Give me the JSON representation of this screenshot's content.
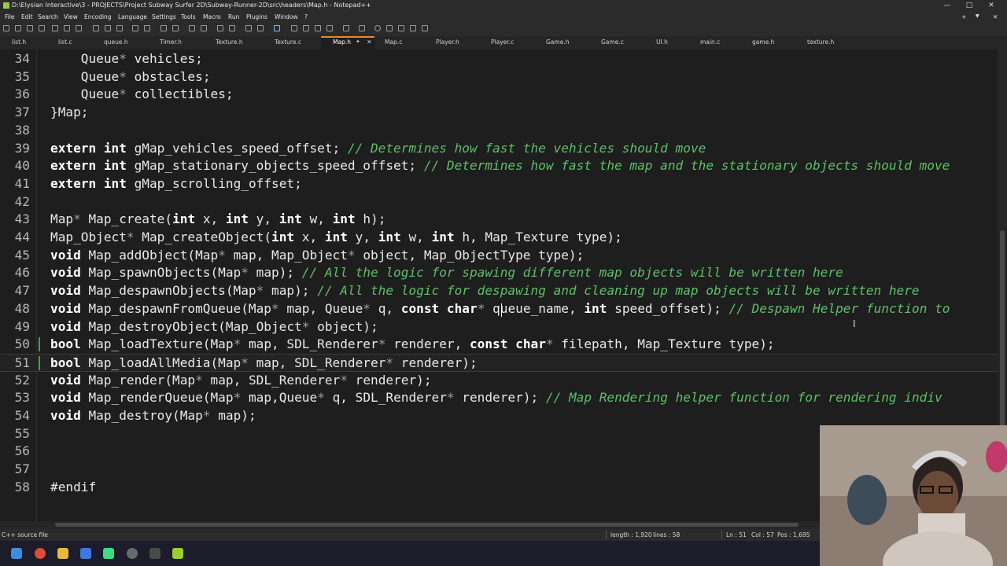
{
  "window": {
    "title": "D:\\Elysian Interactive\\3 - PROJECTS\\Project Subway Surfer 2D\\Subway-Runner-2D\\src\\headers\\Map.h - Notepad++",
    "minimize": "—",
    "maximize": "□",
    "close": "✕"
  },
  "menu": [
    "File",
    "Edit",
    "Search",
    "View",
    "Encoding",
    "Language",
    "Settings",
    "Tools",
    "Macro",
    "Run",
    "Plugins",
    "Window",
    "?"
  ],
  "menu_right": {
    "add": "+",
    "dropdown": "▼",
    "close": "✕"
  },
  "tabs": [
    "list.h",
    "list.c",
    "queue.h",
    "Timer.h",
    "Texture.h",
    "Texture.c",
    "Map.h",
    "Map.c",
    "Player.h",
    "Player.c",
    "Game.h",
    "Game.c",
    "UI.h",
    "main.c",
    "game.h",
    "texture.h"
  ],
  "active_tab_index": 6,
  "tab_close": "✕",
  "tab_pin": "✦",
  "code": [
    {
      "n": "34",
      "t": "    Queue* vehicles;"
    },
    {
      "n": "35",
      "t": "    Queue* obstacles;"
    },
    {
      "n": "36",
      "t": "    Queue* collectibles;"
    },
    {
      "n": "37",
      "t": "}Map;"
    },
    {
      "n": "38",
      "t": ""
    },
    {
      "n": "39",
      "t": "extern int gMap_vehicles_speed_offset; // Determines how fast the vehicles should move"
    },
    {
      "n": "40",
      "t": "extern int gMap_stationary_objects_speed_offset; // Determines how fast the map and the stationary objects should move"
    },
    {
      "n": "41",
      "t": "extern int gMap_scrolling_offset;"
    },
    {
      "n": "42",
      "t": ""
    },
    {
      "n": "43",
      "t": "Map* Map_create(int x, int y, int w, int h);"
    },
    {
      "n": "44",
      "t": "Map_Object* Map_createObject(int x, int y, int w, int h, Map_Texture type);"
    },
    {
      "n": "45",
      "t": "void Map_addObject(Map* map, Map_Object* object, Map_ObjectType type);"
    },
    {
      "n": "46",
      "t": "void Map_spawnObjects(Map* map); // All the logic for spawing different map objects will be written here"
    },
    {
      "n": "47",
      "t": "void Map_despawnObjects(Map* map); // All the logic for despawing and cleaning up map objects will be written here"
    },
    {
      "n": "48",
      "t": "void Map_despawnFromQueue(Map* map, Queue* q, const char* queue_name, int speed_offset); // Despawn Helper function to"
    },
    {
      "n": "49",
      "t": "void Map_destroyObject(Map_Object* object);"
    },
    {
      "n": "50",
      "t": "bool Map_loadTexture(Map* map, SDL_Renderer* renderer, const char* filepath, Map_Texture type);"
    },
    {
      "n": "51",
      "t": "bool Map_loadAllMedia(Map* map, SDL_Renderer* renderer);"
    },
    {
      "n": "52",
      "t": "void Map_render(Map* map, SDL_Renderer* renderer);"
    },
    {
      "n": "53",
      "t": "void Map_renderQueue(Map* map,Queue* q, SDL_Renderer* renderer); // Map Rendering helper function for rendering indiv"
    },
    {
      "n": "54",
      "t": "void Map_destroy(Map* map);"
    },
    {
      "n": "55",
      "t": ""
    },
    {
      "n": "56",
      "t": ""
    },
    {
      "n": "57",
      "t": ""
    },
    {
      "n": "58",
      "t": "#endif"
    }
  ],
  "current_line": "51",
  "modified_lines": [
    "50",
    "51"
  ],
  "status": {
    "filetype": "C++ source file",
    "length": "length : 1,920",
    "lines": "lines : 58",
    "ln": "Ln : 51",
    "col": "Col : 57",
    "pos": "Pos : 1,695"
  },
  "taskbar": [
    "windows-start-icon",
    "chrome-icon",
    "file-explorer-icon",
    "todo-icon",
    "android-studio-icon",
    "obs-icon",
    "terminal-icon",
    "notepad-plus-plus-icon"
  ],
  "colors": {
    "keyword": "#ffffff",
    "comment": "#5fbf6a",
    "text": "#e8e8e8",
    "background": "#1e1e1e",
    "change_marker": "#3fa24a",
    "active_tab": "#e08a3a"
  }
}
